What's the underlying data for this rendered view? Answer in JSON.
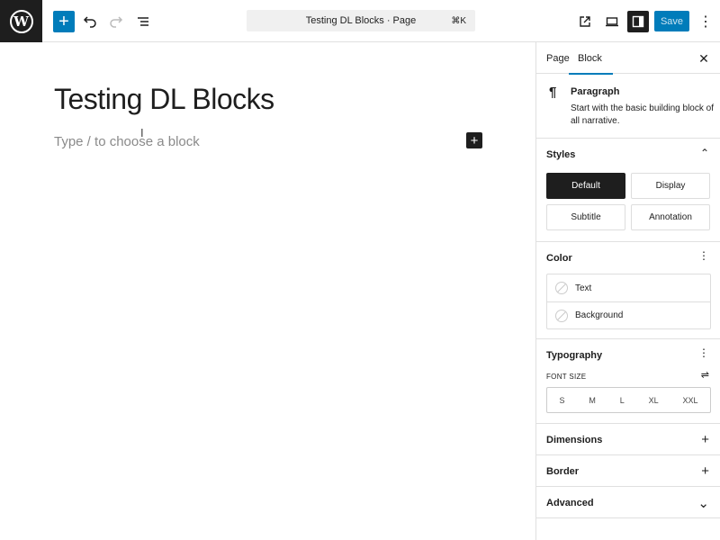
{
  "topbar": {
    "logo_glyph": "W",
    "inserter_glyph": "+",
    "command_title": "Testing DL Blocks · Page",
    "command_shortcut": "⌘K",
    "save_label": "Save",
    "more_glyph": "⋮"
  },
  "canvas": {
    "title": "Testing DL Blocks",
    "placeholder": "Type / to choose a block",
    "cursor_glyph": "I",
    "inserter_glyph": "+"
  },
  "sidebar": {
    "tabs": [
      {
        "label": "Page"
      },
      {
        "label": "Block"
      }
    ],
    "close_glyph": "✕",
    "block": {
      "icon_glyph": "¶",
      "name": "Paragraph",
      "description": "Start with the basic building block of all narrative."
    },
    "styles": {
      "title": "Styles",
      "toggle_glyph": "⌃",
      "options": [
        "Default",
        "Display",
        "Subtitle",
        "Annotation"
      ],
      "selected": "Default"
    },
    "color": {
      "title": "Color",
      "menu_glyph": "⋮",
      "items": [
        "Text",
        "Background"
      ]
    },
    "typography": {
      "title": "Typography",
      "menu_glyph": "⋮",
      "font_size_label": "FONT SIZE",
      "custom_toggle_glyph": "⇌",
      "sizes": [
        "S",
        "M",
        "L",
        "XL",
        "XXL"
      ]
    },
    "dimensions": {
      "title": "Dimensions",
      "action_glyph": "+"
    },
    "border": {
      "title": "Border",
      "action_glyph": "+"
    },
    "advanced": {
      "title": "Advanced",
      "action_glyph": "⌄"
    }
  },
  "colors": {
    "accent": "#007cba",
    "dark": "#1e1e1e",
    "border": "#e0e0e0",
    "placeholder": "#8a8a8a"
  }
}
